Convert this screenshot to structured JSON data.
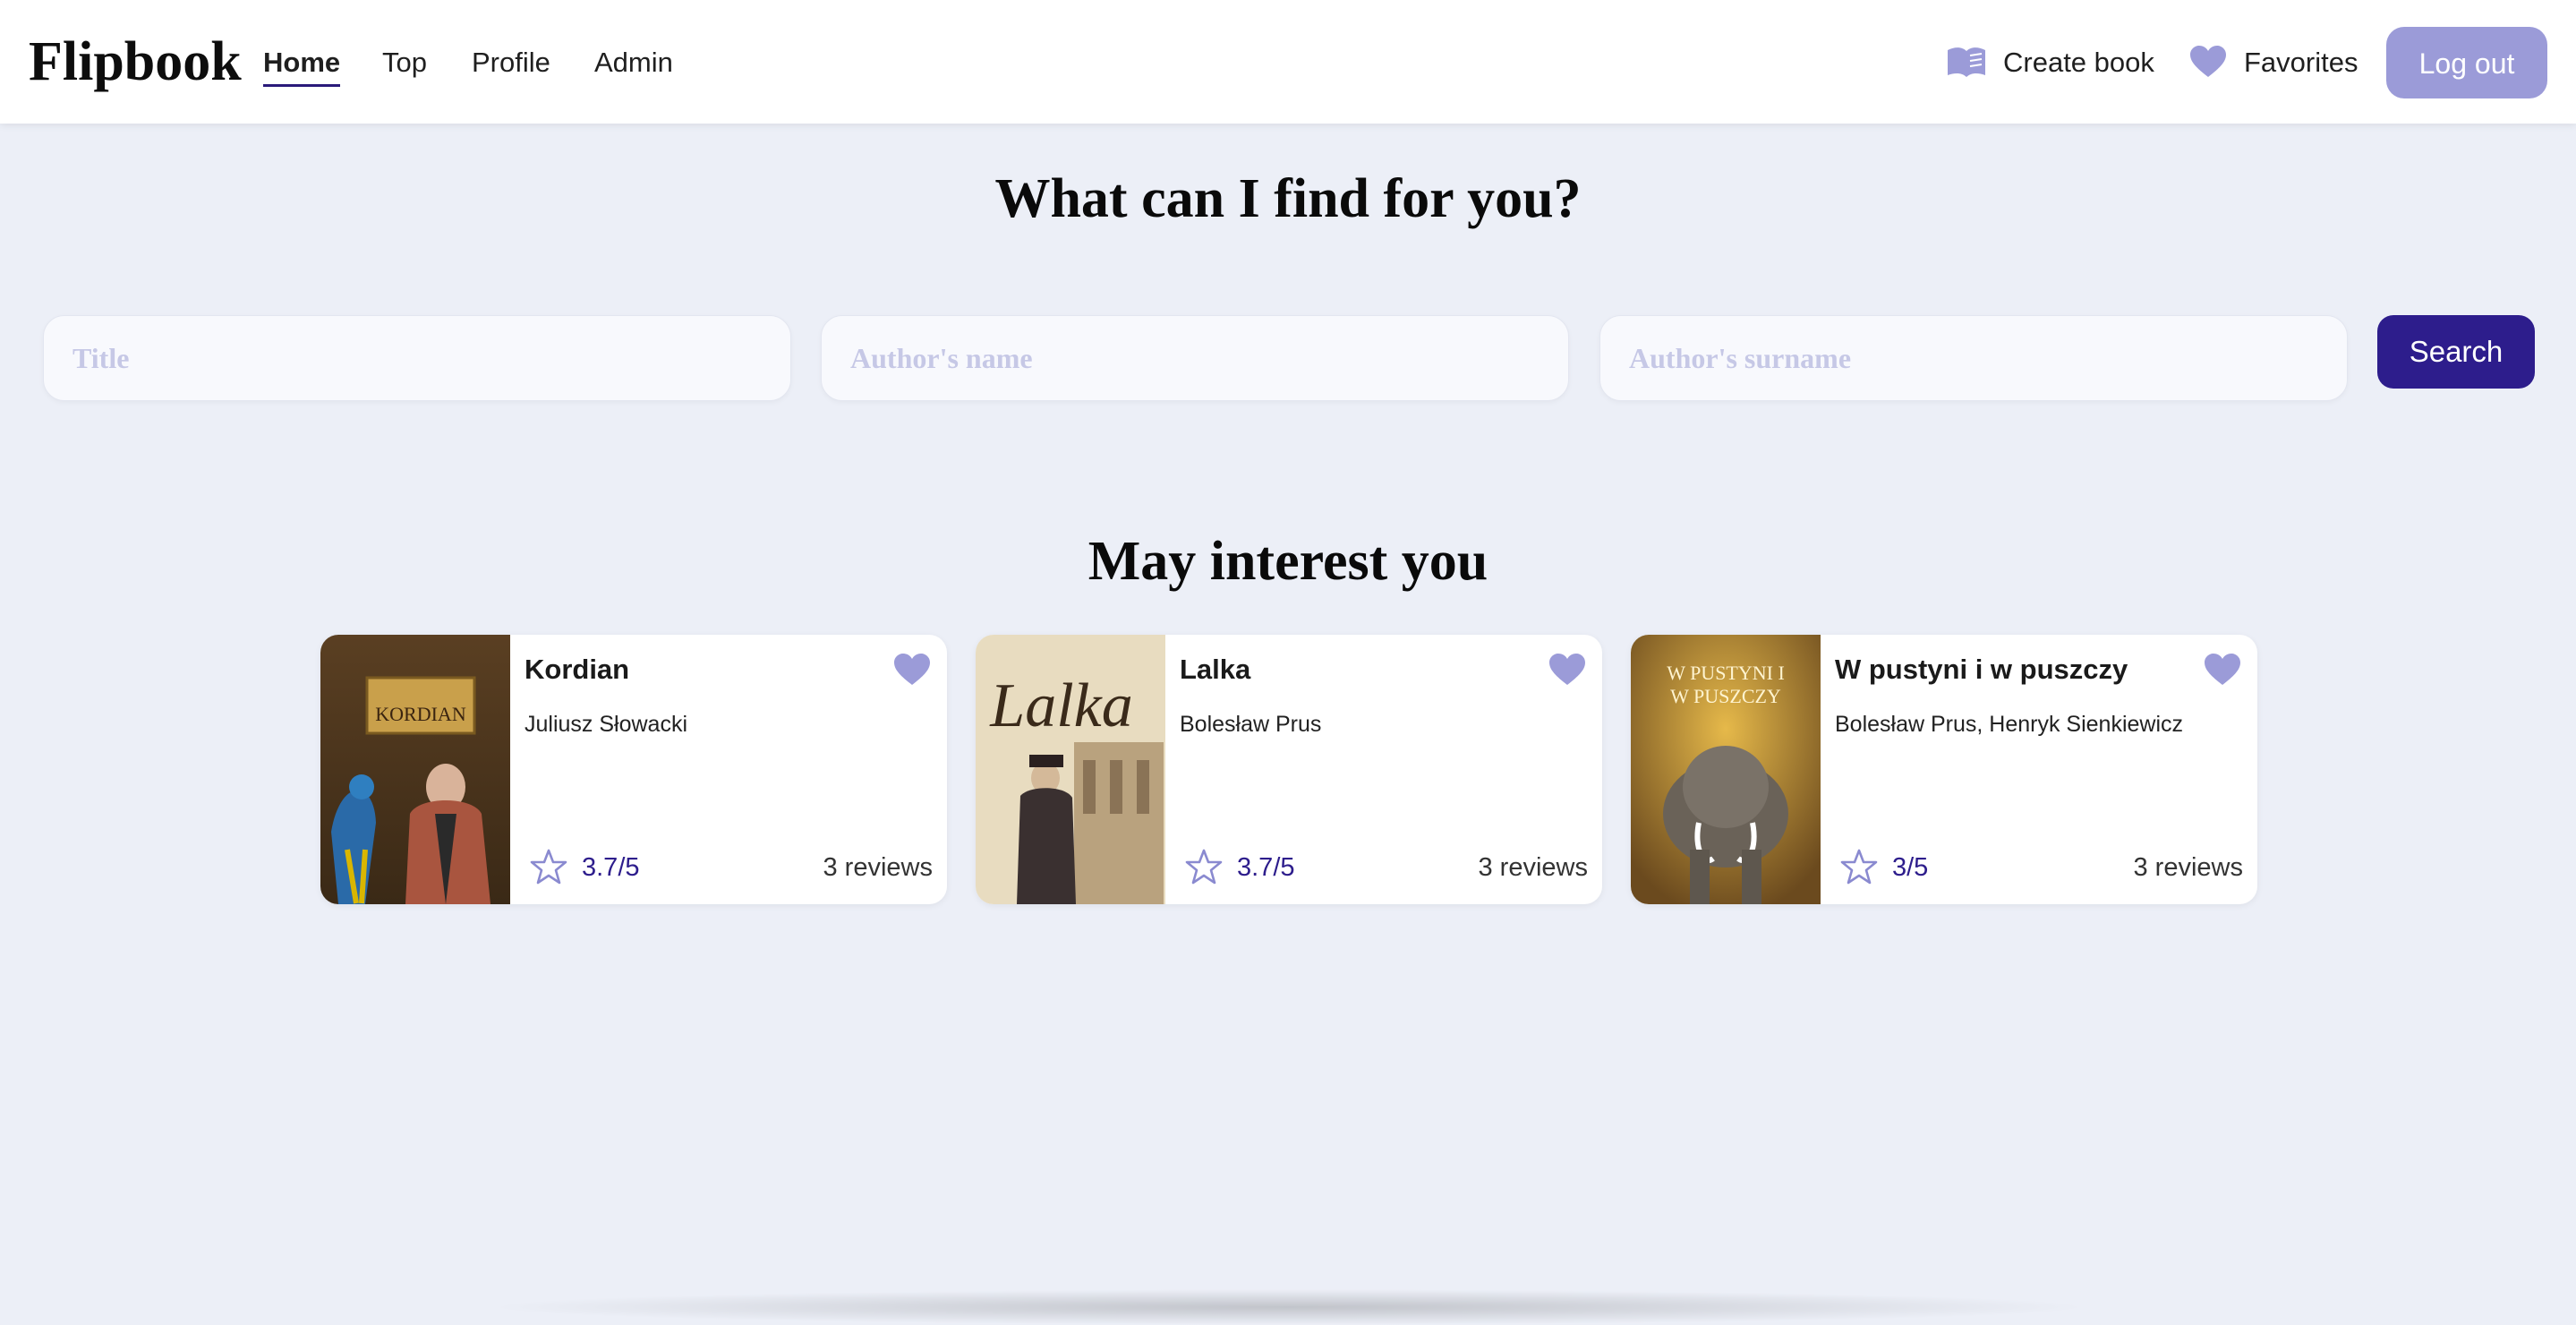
{
  "nav": {
    "logo": "Flipbook",
    "links": [
      "Home",
      "Top",
      "Profile",
      "Admin"
    ],
    "create_book": "Create book",
    "favorites": "Favorites",
    "logout": "Log out"
  },
  "hero": {
    "title": "What can I find for you?"
  },
  "search": {
    "title_placeholder": "Title",
    "author_name_placeholder": "Author's name",
    "author_surname_placeholder": "Author's surname",
    "button": "Search"
  },
  "recommendations": {
    "title": "May interest you",
    "books": [
      {
        "title": "Kordian",
        "authors": "Juliusz Słowacki",
        "rating": "3.7/5",
        "reviews": "3 reviews",
        "cover_text": "KORDIAN"
      },
      {
        "title": "Lalka",
        "authors": "Bolesław Prus",
        "rating": "3.7/5",
        "reviews": "3 reviews",
        "cover_text": "Lalka"
      },
      {
        "title": "W pustyni i w puszczy",
        "authors": "Bolesław Prus, Henryk Sienkiewicz",
        "rating": "3/5",
        "reviews": "3 reviews",
        "cover_text": "W PUSTYNI I W PUSZCZY"
      }
    ]
  },
  "colors": {
    "accent": "#9b9bd8",
    "primary": "#2d1d8c",
    "background": "#eceff7"
  }
}
